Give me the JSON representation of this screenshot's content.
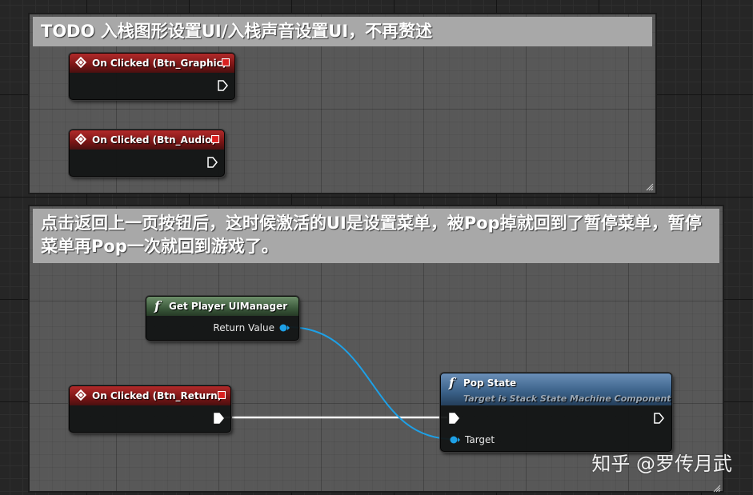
{
  "comments": [
    {
      "id": "comment-todo",
      "title": "TODO 入栈图形设置UI/入栈声音设置UI，不再赘述"
    },
    {
      "id": "comment-return",
      "title": "点击返回上一页按钮后，这时候激活的UI是设置菜单，被Pop掉就回到了暂停菜单，暂停菜单再Pop一次就回到游戏了。"
    }
  ],
  "nodes": {
    "btn_graphic": {
      "title": "On Clicked (Btn_Graphic)"
    },
    "btn_audio": {
      "title": "On Clicked (Btn_Audio)"
    },
    "get_player_uimanager": {
      "title": "Get Player UIManager",
      "output_label": "Return Value"
    },
    "btn_return": {
      "title": "On Clicked (Btn_Return)"
    },
    "pop_state": {
      "title": "Pop State",
      "subtitle": "Target is Stack State Machine Component",
      "target_label": "Target"
    }
  },
  "colors": {
    "event_header": "#b22a2a",
    "pure_header": "#3c5a3c",
    "function_header": "#395f86",
    "object_pin": "#1ea0e6",
    "exec_wire": "#ffffff",
    "comment_title_bg": "#a8a8a8"
  },
  "watermark": "知乎 @罗传月武"
}
